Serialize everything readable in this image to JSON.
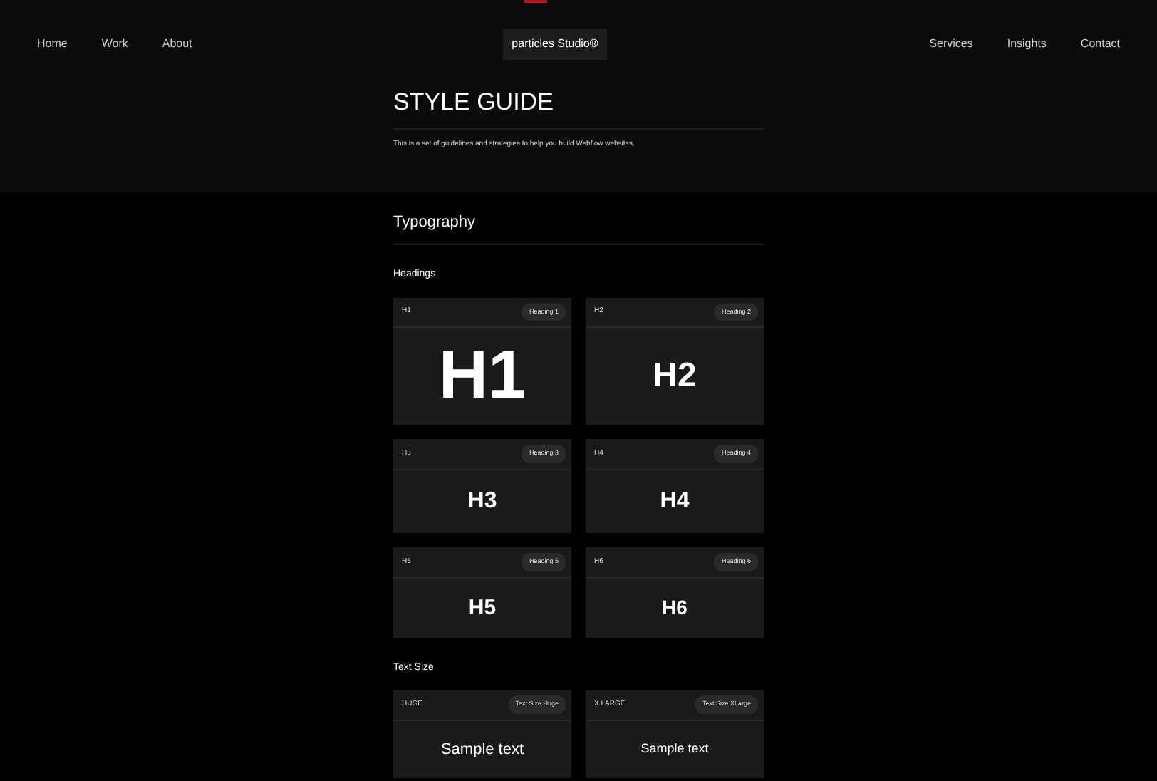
{
  "nav": {
    "left": [
      "Home",
      "Work",
      "About"
    ],
    "brand": "particles Studio®",
    "right": [
      "Services",
      "Insights",
      "Contact"
    ]
  },
  "hero": {
    "title": "STYLE GUIDE",
    "description": "This is a set of guidelines and strategies to help you build Webflow websites."
  },
  "section": {
    "title": "Typography",
    "groups": [
      {
        "title": "Headings",
        "cards": [
          {
            "kind": "h1",
            "tag": "H1",
            "badge": "Heading 1",
            "sample": "H1"
          },
          {
            "kind": "h2",
            "tag": "H2",
            "badge": "Heading 2",
            "sample": "H2"
          },
          {
            "kind": "h3",
            "tag": "H3",
            "badge": "Heading 3",
            "sample": "H3"
          },
          {
            "kind": "h4",
            "tag": "H4",
            "badge": "Heading 4",
            "sample": "H4"
          },
          {
            "kind": "h5",
            "tag": "H5",
            "badge": "Heading 5",
            "sample": "H5"
          },
          {
            "kind": "h6",
            "tag": "H6",
            "badge": "Heading 6",
            "sample": "H6"
          }
        ]
      },
      {
        "title": "Text Size",
        "cards": [
          {
            "kind": "huge",
            "tag": "HUGE",
            "badge": "Text Size Huge",
            "sample": "Sample text"
          },
          {
            "kind": "xlarge",
            "tag": "X LARGE",
            "badge": "Text Size XLarge",
            "sample": "Sample text"
          }
        ]
      }
    ]
  }
}
